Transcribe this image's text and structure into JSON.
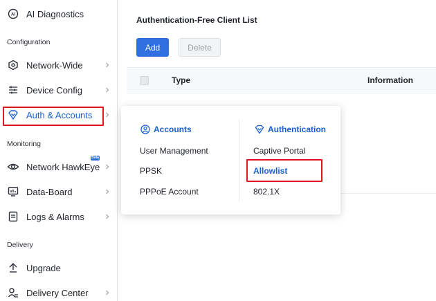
{
  "sidebar": {
    "items": [
      {
        "label": "AI Diagnostics",
        "icon": "ai-diagnostics-icon"
      },
      {
        "label": "Network-Wide",
        "icon": "network-wide-icon"
      },
      {
        "label": "Device Config",
        "icon": "sliders-icon"
      },
      {
        "label": "Auth & Accounts",
        "icon": "shield-heart-icon"
      },
      {
        "label": "Network HawkEye",
        "icon": "eye-icon"
      },
      {
        "label": "Data-Board",
        "icon": "monitor-chart-icon"
      },
      {
        "label": "Logs & Alarms",
        "icon": "log-icon"
      },
      {
        "label": "Upgrade",
        "icon": "upgrade-icon"
      },
      {
        "label": "Delivery Center",
        "icon": "delivery-icon"
      }
    ],
    "sections": {
      "configuration": "Configuration",
      "monitoring": "Monitoring",
      "delivery": "Delivery"
    },
    "beta_badge": "Beta",
    "active_item": "Auth & Accounts"
  },
  "main": {
    "title": "Authentication-Free Client List",
    "add_label": "Add",
    "delete_label": "Delete",
    "columns": [
      "Type",
      "Information"
    ]
  },
  "popover": {
    "accounts": {
      "heading": "Accounts",
      "items": [
        "User Management",
        "PPSK",
        "PPPoE Account"
      ]
    },
    "authentication": {
      "heading": "Authentication",
      "items": [
        "Captive Portal",
        "Allowlist",
        "802.1X"
      ],
      "active": "Allowlist"
    }
  },
  "colors": {
    "accent": "#2f6fe0",
    "highlight": "#e0141e",
    "active_text": "#1a5fd1"
  }
}
